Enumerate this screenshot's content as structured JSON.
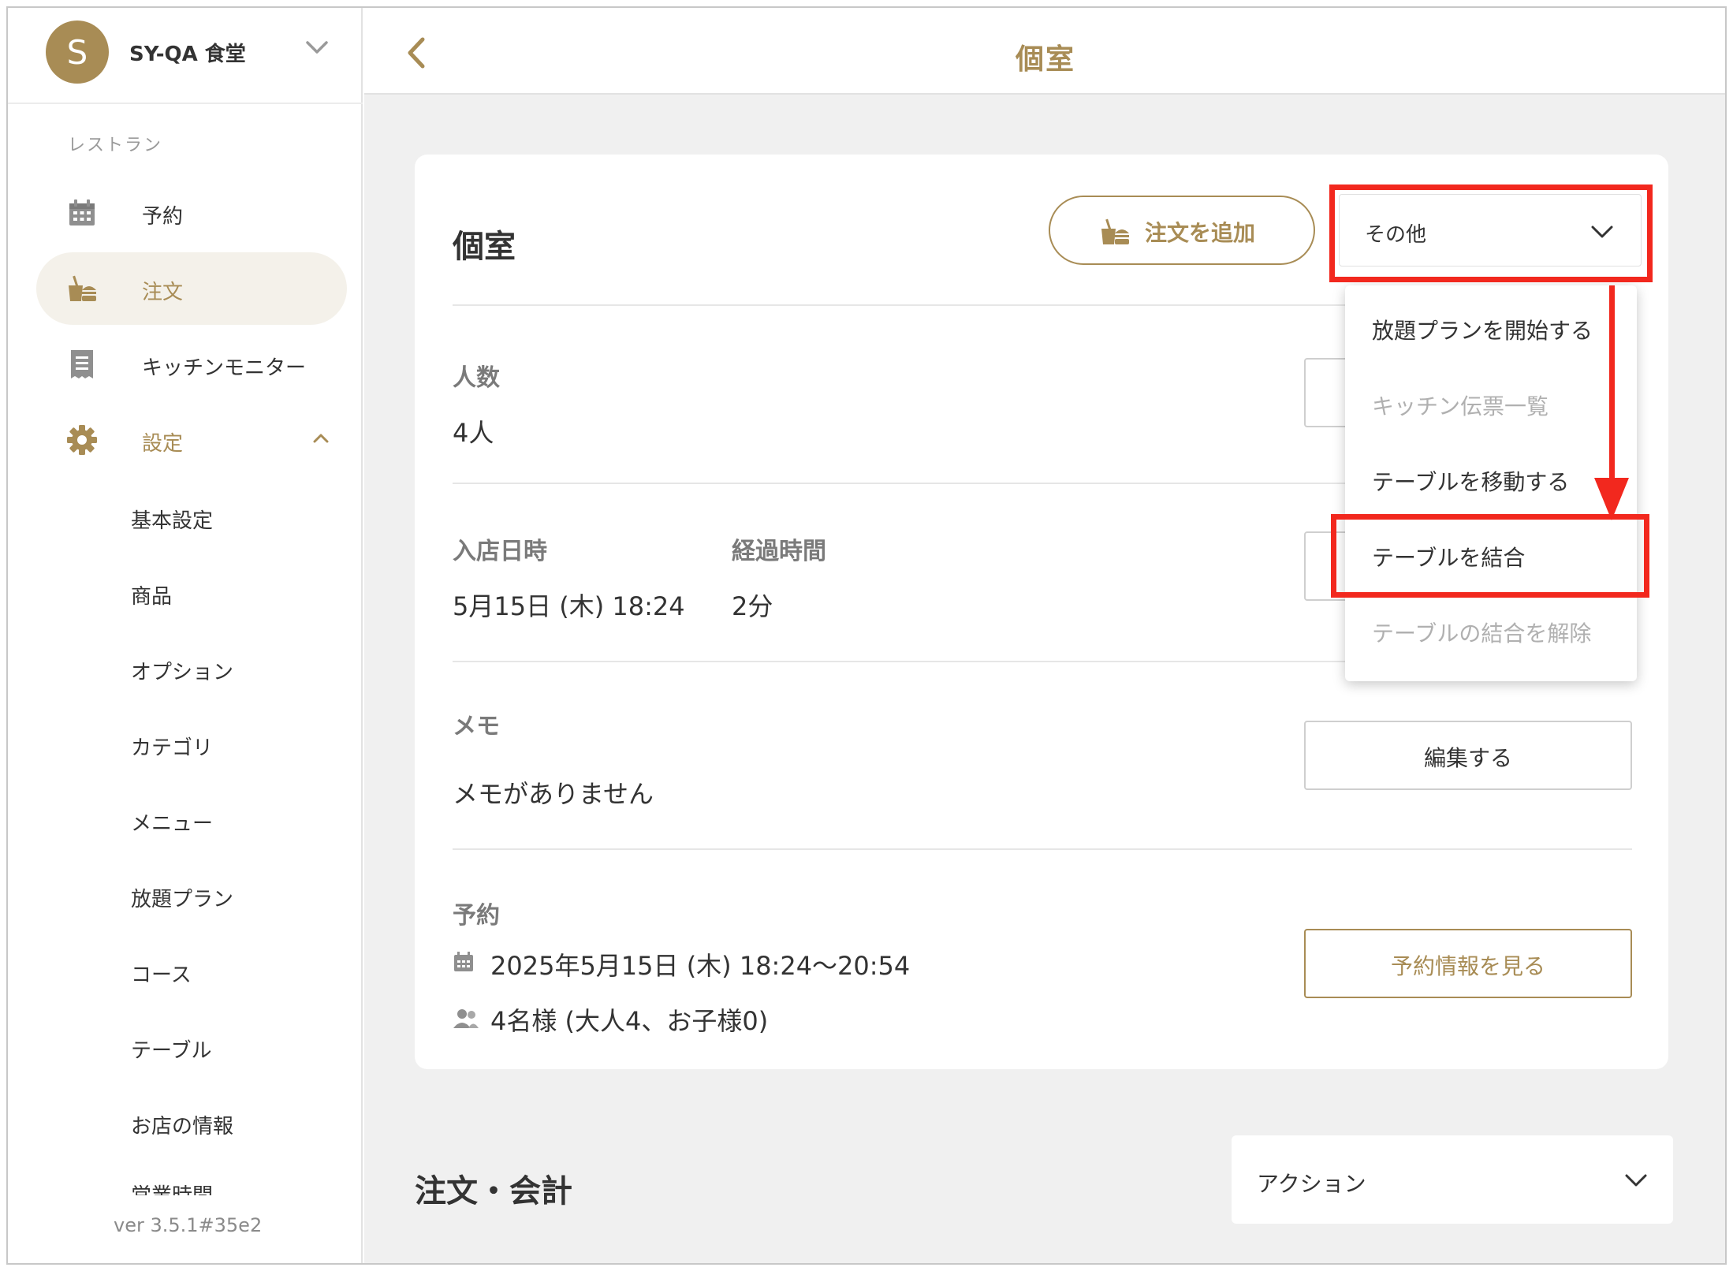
{
  "store": {
    "initial": "S",
    "name": "SY-QA 食堂"
  },
  "sidebar": {
    "section_label": "レストラン",
    "items": [
      {
        "label": "予約",
        "icon": "calendar-icon"
      },
      {
        "label": "注文",
        "icon": "order-icon",
        "active": true
      },
      {
        "label": "キッチンモニター",
        "icon": "receipt-icon"
      },
      {
        "label": "設定",
        "icon": "gear-icon",
        "expanded": true
      }
    ],
    "settings_items": [
      "基本設定",
      "商品",
      "オプション",
      "カテゴリ",
      "メニュー",
      "放題プラン",
      "コース",
      "テーブル",
      "お店の情報",
      "営業時間"
    ],
    "version": "ver 3.5.1#35e2"
  },
  "header": {
    "title": "個室"
  },
  "card": {
    "title": "個室",
    "add_order_label": "注文を追加",
    "more_label": "その他",
    "people": {
      "label": "人数",
      "value": "4人"
    },
    "checkin": {
      "label": "入店日時",
      "value": "5月15日 (木) 18:24"
    },
    "elapsed": {
      "label": "経過時間",
      "value": "2分"
    },
    "memo": {
      "label": "メモ",
      "value": "メモがありません",
      "edit_label": "編集する"
    },
    "reservation": {
      "label": "予約",
      "datetime": "2025年5月15日 (木) 18:24～20:54",
      "guests": "4名様 (大人4、お子様0)",
      "view_label": "予約情報を見る"
    }
  },
  "orders": {
    "title": "注文・会計",
    "action_label": "アクション"
  },
  "more_menu": {
    "items": [
      {
        "label": "放題プランを開始する",
        "disabled": false
      },
      {
        "label": "キッチン伝票一覧",
        "disabled": true
      },
      {
        "label": "テーブルを移動する",
        "disabled": false
      },
      {
        "label": "テーブルを結合",
        "disabled": false,
        "highlighted": true
      },
      {
        "label": "テーブルの結合を解除",
        "disabled": true
      }
    ]
  },
  "colors": {
    "accent": "#a88c55",
    "annotation": "#f2281e",
    "active_bg": "#f4f1ea"
  }
}
